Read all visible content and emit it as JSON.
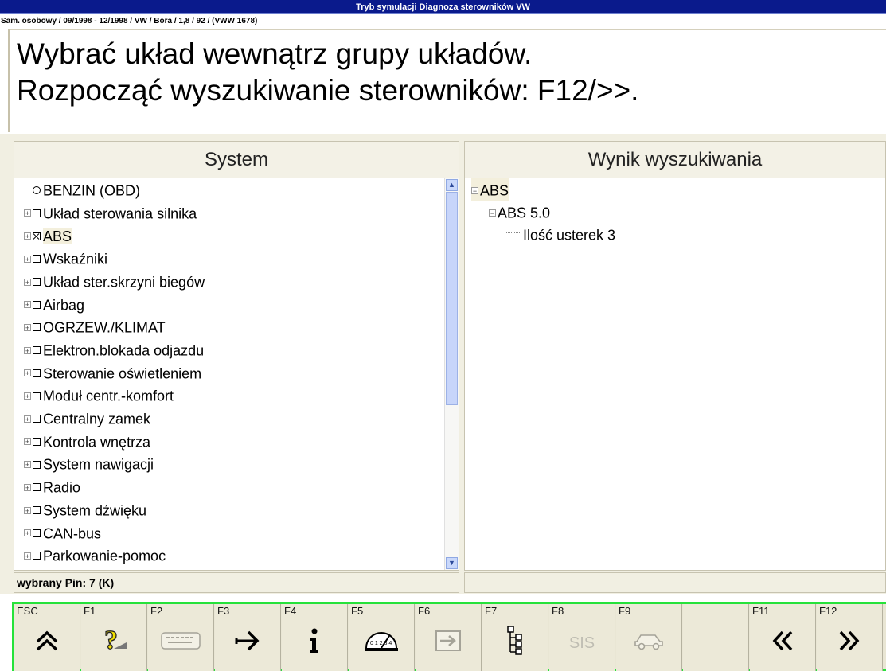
{
  "window": {
    "title": "Tryb symulacji Diagnoza sterowników VW",
    "vehicle_info": "Sam. osobowy / 09/1998 - 12/1998 / VW / Bora / 1,8 / 92 /  (VWW 1678)"
  },
  "instructions": {
    "line1": "Wybrać układ wewnątrz grupy układów.",
    "line2": "Rozpocząć wyszukiwanie sterowników: F12/>>."
  },
  "system_panel": {
    "title": "System",
    "items": [
      {
        "label": "BENZIN (OBD)",
        "mark": "radio"
      },
      {
        "label": "Układ sterowania silnika",
        "mark": "box"
      },
      {
        "label": "ABS",
        "mark": "checked"
      },
      {
        "label": "Wskaźniki",
        "mark": "box"
      },
      {
        "label": "Układ ster.skrzyni biegów",
        "mark": "box"
      },
      {
        "label": "Airbag",
        "mark": "box"
      },
      {
        "label": "OGRZEW./KLIMAT",
        "mark": "box"
      },
      {
        "label": "Elektron.blokada odjazdu",
        "mark": "box"
      },
      {
        "label": "Sterowanie oświetleniem",
        "mark": "box"
      },
      {
        "label": "Moduł centr.-komfort",
        "mark": "box"
      },
      {
        "label": "Centralny zamek",
        "mark": "box"
      },
      {
        "label": "Kontrola wnętrza",
        "mark": "box"
      },
      {
        "label": "System nawigacji",
        "mark": "box"
      },
      {
        "label": "Radio",
        "mark": "box"
      },
      {
        "label": "System dźwięku",
        "mark": "box"
      },
      {
        "label": "CAN-bus",
        "mark": "box"
      },
      {
        "label": "Parkowanie-pomoc",
        "mark": "box"
      }
    ],
    "status": "wybrany Pin: 7 (K)"
  },
  "results_panel": {
    "title": "Wynik wyszukiwania",
    "tree": [
      {
        "label": "ABS"
      },
      {
        "label": "ABS 5.0"
      },
      {
        "label": "Ilość usterek 3"
      }
    ]
  },
  "function_keys": [
    {
      "key": "ESC",
      "icon": "double-chevron-up-icon",
      "enabled": true
    },
    {
      "key": "F1",
      "icon": "help-question-icon",
      "enabled": true
    },
    {
      "key": "F2",
      "icon": "keyboard-icon",
      "enabled": false
    },
    {
      "key": "F3",
      "icon": "arrow-enter-icon",
      "enabled": true
    },
    {
      "key": "F4",
      "icon": "info-icon",
      "enabled": true
    },
    {
      "key": "F5",
      "icon": "gauge-icon",
      "enabled": true
    },
    {
      "key": "F6",
      "icon": "box-arrow-icon",
      "enabled": false
    },
    {
      "key": "F7",
      "icon": "tree-structure-icon",
      "enabled": true
    },
    {
      "key": "F8",
      "icon": "sis-text-icon",
      "label": "SIS",
      "enabled": false
    },
    {
      "key": "F9",
      "icon": "car-icon",
      "enabled": false
    },
    {
      "key": "",
      "icon": "",
      "enabled": false
    },
    {
      "key": "F11",
      "icon": "double-chevron-left-icon",
      "enabled": true
    },
    {
      "key": "F12",
      "icon": "double-chevron-right-icon",
      "enabled": true
    }
  ],
  "colors": {
    "title_bar": "#0a1a8c",
    "function_bar_border": "#26e23a",
    "panel_background": "#f1efe2",
    "selection": "#f3efdc"
  }
}
